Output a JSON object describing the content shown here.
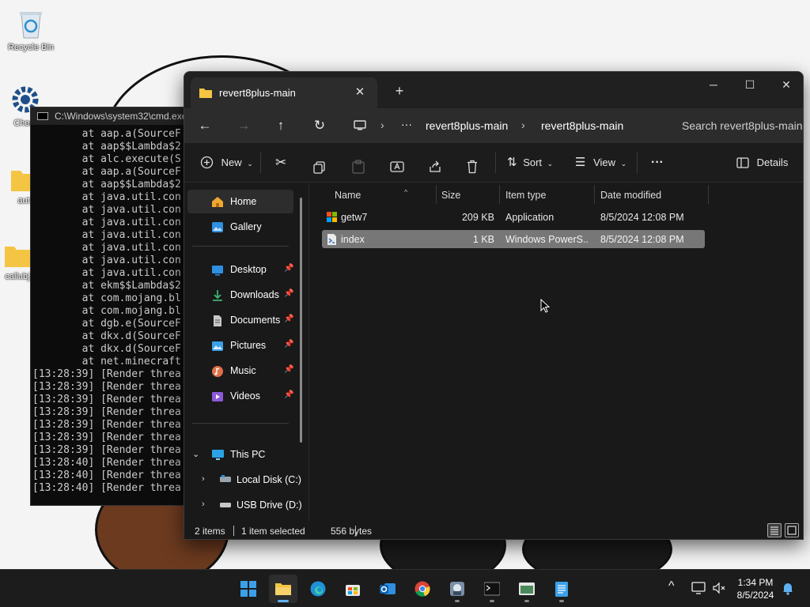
{
  "desktop": {
    "icons": [
      {
        "label": "Recycle Bin",
        "icon": "recycle-bin-icon"
      },
      {
        "label": "Cheat",
        "icon": "gear-icon"
      },
      {
        "label": "aut",
        "icon": "folder-icon"
      },
      {
        "label": "callubj",
        "icon": "folder-icon"
      }
    ]
  },
  "cmd": {
    "title": "C:\\Windows\\system32\\cmd.exe",
    "lines": [
      "        at aap.a(SourceF",
      "        at aap$$Lambda$2",
      "        at alc.execute(S",
      "        at aap.a(SourceF",
      "        at aap$$Lambda$2",
      "        at java.util.con",
      "        at java.util.con",
      "        at java.util.con",
      "        at java.util.con",
      "        at java.util.con",
      "        at java.util.con",
      "        at java.util.con",
      "        at ekm$$Lambda$2",
      "        at com.mojang.bl",
      "        at com.mojang.bl",
      "        at dgb.e(SourceF",
      "        at dkx.d(SourceF",
      "        at dkx.d(SourceF",
      "        at net.minecraft",
      "[13:28:39] [Render threa",
      "[13:28:39] [Render threa",
      "[13:28:39] [Render threa",
      "[13:28:39] [Render threa",
      "[13:28:39] [Render threa",
      "[13:28:39] [Render threa",
      "[13:28:39] [Render threa",
      "[13:28:40] [Render threa",
      "[13:28:40] [Render threa",
      "[13:28:40] [Render threa"
    ]
  },
  "explorer": {
    "tab_title": "revert8plus-main",
    "tab_close": "✕",
    "new_tab": "+",
    "window_controls": {
      "minimize": "─",
      "maximize": "☐",
      "close": "✕"
    },
    "nav": {
      "back": "←",
      "forward": "→",
      "up": "↑",
      "refresh": "↻"
    },
    "breadcrumb": {
      "more": "···",
      "items": [
        "revert8plus-main",
        "revert8plus-main"
      ]
    },
    "search_placeholder": "Search revert8plus-main",
    "toolbar": {
      "new": "New",
      "sort": "Sort",
      "view": "View",
      "more": "···",
      "details": "Details"
    },
    "navpane": {
      "home": "Home",
      "gallery": "Gallery",
      "quick": [
        {
          "label": "Desktop",
          "icon": "desktop-icon",
          "color": "#2f8fe0"
        },
        {
          "label": "Downloads",
          "icon": "download-icon",
          "color": "#3cb371"
        },
        {
          "label": "Documents",
          "icon": "documents-icon",
          "color": "#c8c8c8"
        },
        {
          "label": "Pictures",
          "icon": "pictures-icon",
          "color": "#3aa0e8"
        },
        {
          "label": "Music",
          "icon": "music-icon",
          "color": "#e0704a"
        },
        {
          "label": "Videos",
          "icon": "videos-icon",
          "color": "#8a5ad8"
        }
      ],
      "this_pc": "This PC",
      "drives": [
        "Local Disk (C:)",
        "USB Drive (D:)"
      ]
    },
    "columns": {
      "name": "Name",
      "size": "Size",
      "type": "Item type",
      "date": "Date modified"
    },
    "files": [
      {
        "name": "getw7",
        "size": "209 KB",
        "type": "Application",
        "date": "8/5/2024 12:08 PM",
        "icon": "application-icon",
        "selected": false
      },
      {
        "name": "index",
        "size": "1 KB",
        "type": "Windows PowerS...",
        "date": "8/5/2024 12:08 PM",
        "icon": "powershell-script-icon",
        "selected": true
      }
    ],
    "status": {
      "count": "2 items",
      "selected": "1 item selected",
      "bytes": "556 bytes"
    }
  },
  "taskbar": {
    "apps": [
      {
        "name": "start",
        "icon": "windows-start-icon"
      },
      {
        "name": "file-explorer",
        "icon": "folder-icon"
      },
      {
        "name": "edge",
        "icon": "edge-icon"
      },
      {
        "name": "store",
        "icon": "store-icon"
      },
      {
        "name": "outlook",
        "icon": "outlook-icon"
      },
      {
        "name": "chrome",
        "icon": "chrome-icon"
      },
      {
        "name": "game",
        "icon": "game-icon"
      },
      {
        "name": "terminal",
        "icon": "terminal-icon"
      },
      {
        "name": "app",
        "icon": "app-window-icon"
      },
      {
        "name": "notepad",
        "icon": "notepad-icon"
      }
    ],
    "time": "1:34 PM",
    "date": "8/5/2024"
  }
}
